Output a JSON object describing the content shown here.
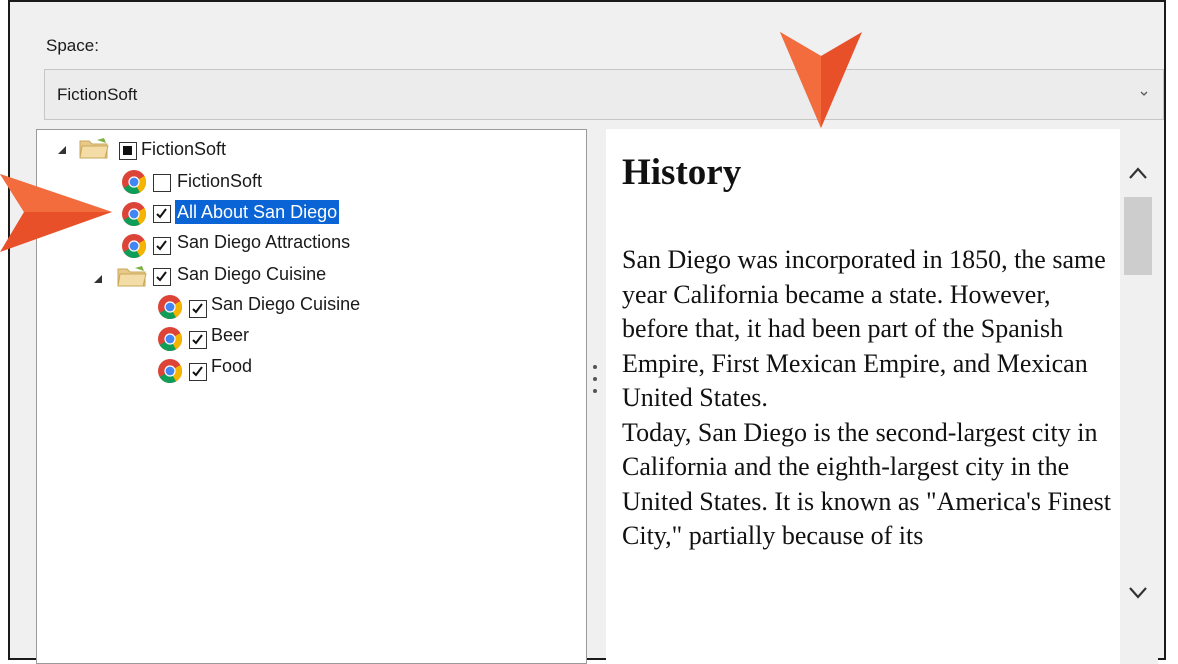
{
  "space": {
    "label": "Space:",
    "selected_value": "FictionSoft"
  },
  "tree": {
    "root": {
      "label": "FictionSoft",
      "state": "partial",
      "expanded": true,
      "icon": "folder-icon"
    },
    "items": [
      {
        "label": "FictionSoft",
        "checked": false,
        "icon": "chrome-icon"
      },
      {
        "label": "All About San Diego",
        "checked": true,
        "selected": true,
        "icon": "chrome-icon"
      },
      {
        "label": "San Diego Attractions",
        "checked": true,
        "icon": "chrome-icon"
      }
    ],
    "subfolder": {
      "label": "San Diego Cuisine",
      "checked": true,
      "expanded": true,
      "icon": "folder-icon",
      "items": [
        {
          "label": "San Diego Cuisine",
          "checked": true,
          "icon": "chrome-icon"
        },
        {
          "label": "Beer",
          "checked": true,
          "icon": "chrome-icon"
        },
        {
          "label": "Food",
          "checked": true,
          "icon": "chrome-icon"
        }
      ]
    }
  },
  "preview": {
    "title": "History",
    "paragraph1": "San Diego was incorporated in 1850, the same year California became a state. However, before that, it had been part of the Spanish Empire, First Mexican Empire, and Mexican United States.",
    "paragraph2": "Today, San Diego is the second-largest city in California and the eighth-largest city in the United States. It is known as \"America's Finest City,\" partially because of its"
  },
  "colors": {
    "selection": "#0a64d6",
    "callout_arrow": "#e8502a"
  }
}
